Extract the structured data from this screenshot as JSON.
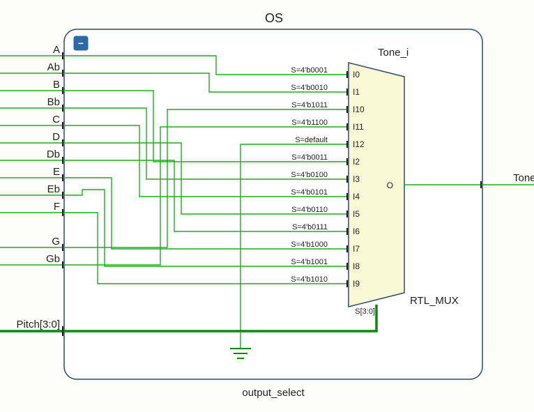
{
  "module": {
    "title": "OS",
    "type_label": "output_select",
    "collapse_glyph": "−"
  },
  "instance": {
    "name": "Tone_i",
    "type_label": "RTL_MUX",
    "output_label": "O",
    "select_label": "S[3:0]"
  },
  "left_ports": [
    "A",
    "Ab",
    "B",
    "Bb",
    "C",
    "D",
    "Db",
    "E",
    "Eb",
    "F",
    "",
    "G",
    "Gb",
    "",
    "Pitch[3:0]"
  ],
  "right_ports": [
    "Tone"
  ],
  "mux_inputs": [
    {
      "sel": "S=4'b0001",
      "pin": "I0"
    },
    {
      "sel": "S=4'b0010",
      "pin": "I1"
    },
    {
      "sel": "S=4'b1011",
      "pin": "I10"
    },
    {
      "sel": "S=4'b1100",
      "pin": "I11"
    },
    {
      "sel": "S=default",
      "pin": "I12"
    },
    {
      "sel": "S=4'b0011",
      "pin": "I2"
    },
    {
      "sel": "S=4'b0100",
      "pin": "I3"
    },
    {
      "sel": "S=4'b0101",
      "pin": "I4"
    },
    {
      "sel": "S=4'b0110",
      "pin": "I5"
    },
    {
      "sel": "S=4'b0111",
      "pin": "I6"
    },
    {
      "sel": "S=4'b1000",
      "pin": "I7"
    },
    {
      "sel": "S=4'b1001",
      "pin": "I8"
    },
    {
      "sel": "S=4'b1010",
      "pin": "I9"
    }
  ]
}
